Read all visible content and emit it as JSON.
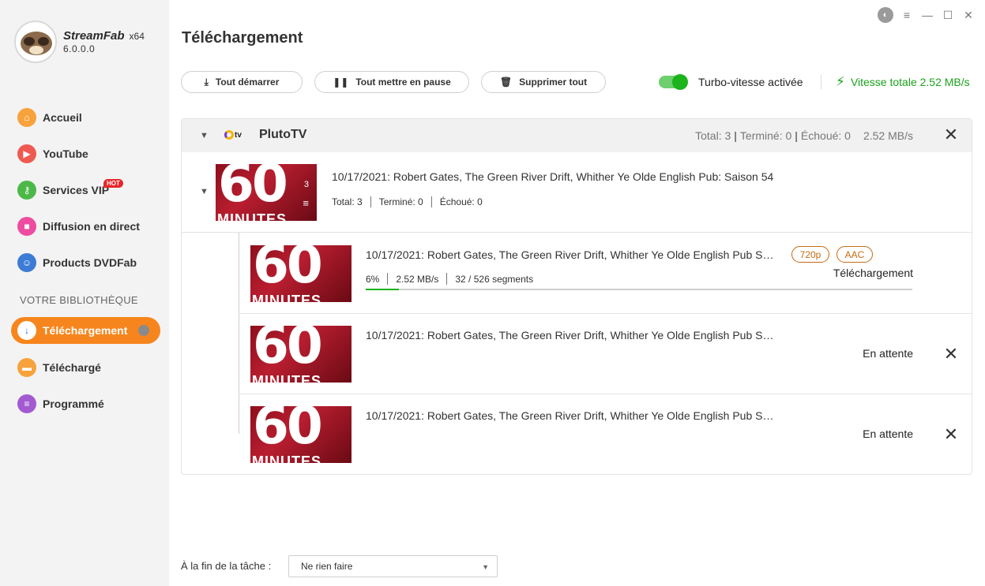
{
  "app": {
    "name": "StreamFab",
    "arch": "x64",
    "version": "6.0.0.0"
  },
  "sidebar": {
    "items": [
      {
        "label": "Accueil",
        "icon": "home-icon",
        "color": "#f7a23b"
      },
      {
        "label": "YouTube",
        "icon": "youtube-icon",
        "color": "#ee5a52"
      },
      {
        "label": "Services VIP",
        "icon": "key-icon",
        "color": "#4cb848",
        "badge": "HOT"
      },
      {
        "label": "Diffusion en direct",
        "icon": "camera-icon",
        "color": "#ee4ca0"
      },
      {
        "label": "Products DVDFab",
        "icon": "dvdfab-icon",
        "color": "#3c7bd6"
      }
    ],
    "section_title": "VOTRE BIBLIOTHÈQUE",
    "library": [
      {
        "label": "Téléchargement",
        "icon": "download-icon",
        "active": true
      },
      {
        "label": "Téléchargé",
        "icon": "folder-icon",
        "color": "#f7a23b"
      },
      {
        "label": "Programmé",
        "icon": "schedule-icon",
        "color": "#a35ad0"
      }
    ]
  },
  "main": {
    "title": "Téléchargement",
    "toolbar": {
      "start_all": "Tout démarrer",
      "pause_all": "Tout mettre en pause",
      "delete_all": "Supprimer tout",
      "turbo_label": "Turbo-vitesse activée",
      "turbo_on": true,
      "total_speed": "Vitesse totale 2.52 MB/s"
    },
    "group": {
      "name": "PlutoTV",
      "stats_total": "Total: 3",
      "stats_done": "Terminé: 0",
      "stats_failed": "Échoué: 0",
      "stats_speed": "2.52 MB/s",
      "parent": {
        "title": "10/17/2021: Robert Gates, The Green River Drift, Whither Ye Olde English Pub: Saison 54",
        "total": "Total: 3",
        "done": "Terminé: 0",
        "failed": "Échoué: 0",
        "count": "3",
        "thumb_text": "60",
        "thumb_sub": "MINUTES"
      },
      "children": [
        {
          "title": "10/17/2021: Robert Gates, The Green River Drift, Whither Ye Olde English Pub S…",
          "tags": [
            "720p",
            "AAC"
          ],
          "status": "Téléchargement",
          "percent": "6%",
          "progress": 0.06,
          "speed": "2.52 MB/s",
          "segments": "32 / 526 segments"
        },
        {
          "title": "10/17/2021: Robert Gates, The Green River Drift, Whither Ye Olde English Pub S…",
          "status": "En attente"
        },
        {
          "title": "10/17/2021: Robert Gates, The Green River Drift, Whither Ye Olde English Pub S…",
          "status": "En attente"
        }
      ]
    },
    "footer": {
      "label": "À la fin de la tâche :",
      "select_value": "Ne rien faire"
    }
  },
  "colors": {
    "accent": "#f7851d",
    "green": "#1aa31a",
    "tag": "#c46b13"
  }
}
